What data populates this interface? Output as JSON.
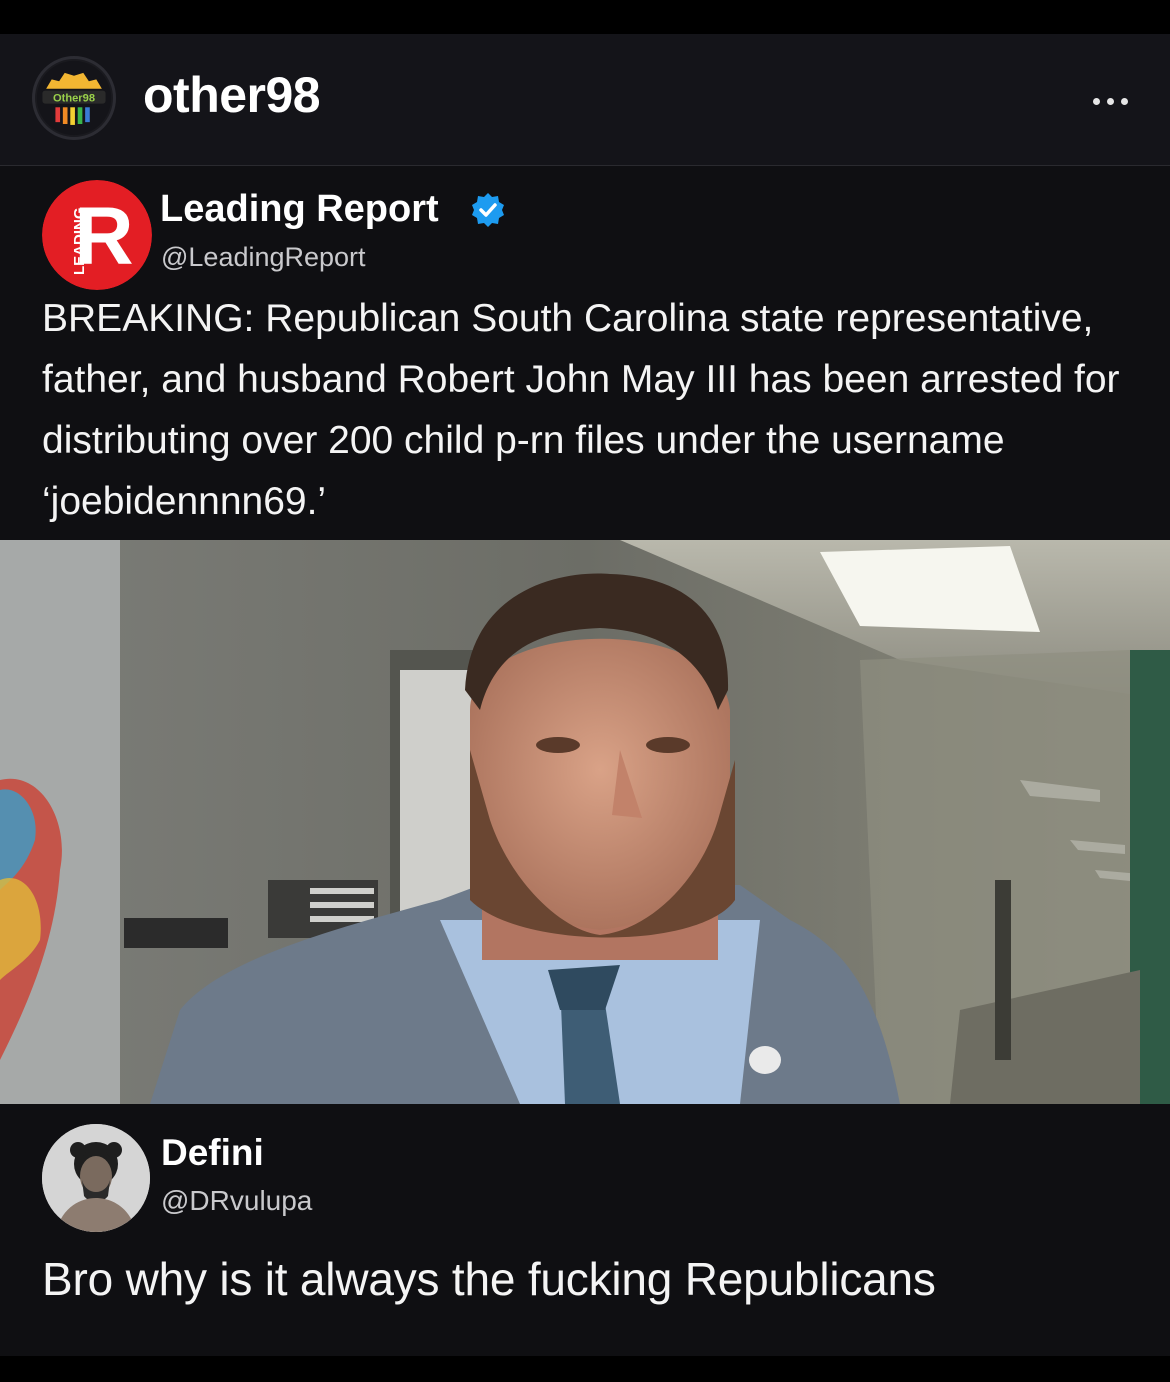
{
  "post": {
    "username": "other98",
    "avatar_icon": "other98-logo",
    "avatar_text": "Other98",
    "menu_icon": "more-options-icon"
  },
  "tweet": {
    "author_name": "Leading Report",
    "author_handle": "@LeadingReport",
    "avatar_icon": "leading-report-logo",
    "avatar_letter": "R",
    "avatar_side_text": "LEADING",
    "verified_icon": "verified-badge-icon",
    "text": "BREAKING: Republican South Carolina state representative, father, and husband Robert John May III has been arrested for distributing over 200 child p-rn files under the username ‘joebidennnn69.’",
    "photo_icon": "news-photo-man-in-hallway"
  },
  "reply": {
    "author_name": "Defini",
    "author_handle": "@DRvulupa",
    "avatar_icon": "portrait-avatar",
    "text": "Bro why is it always the fucking Republicans"
  },
  "colors": {
    "header_bg": "#141419",
    "card_bg": "#0f0f12",
    "verified_blue": "#1d9bf0",
    "brand_red": "#e31e24"
  }
}
